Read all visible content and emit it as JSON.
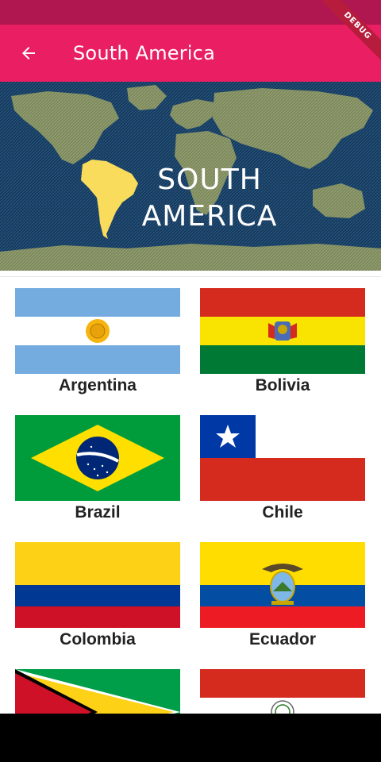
{
  "app_bar": {
    "title": "South America",
    "back_icon": "arrow-back-icon"
  },
  "debug_banner": {
    "label": "DEBUG"
  },
  "hero": {
    "line1": "SOUTH",
    "line2": "AMERICA"
  },
  "countries": [
    {
      "name": "Argentina"
    },
    {
      "name": "Bolivia"
    },
    {
      "name": "Brazil"
    },
    {
      "name": "Chile"
    },
    {
      "name": "Colombia"
    },
    {
      "name": "Ecuador"
    },
    {
      "name": ""
    },
    {
      "name": ""
    }
  ],
  "colors": {
    "accent": "#e91e63",
    "status_bar": "#b01750",
    "hero_bg": "#1a3a5c",
    "continent": "#f9dc5c"
  }
}
